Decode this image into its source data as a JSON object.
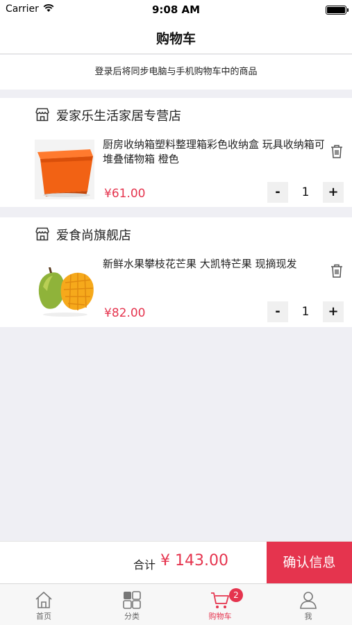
{
  "status_bar": {
    "carrier": "Carrier",
    "time": "9:08 AM"
  },
  "nav": {
    "title": "购物车"
  },
  "login_tip": "登录后将同步电脑与手机购物车中的商品",
  "stores": [
    {
      "name": "爱家乐生活家居专营店",
      "product": {
        "title": "厨房收纳箱塑料整理箱彩色收纳盒 玩具收纳箱可堆叠储物箱 橙色",
        "price": "¥61.00",
        "quantity": "1",
        "image": "orange-storage-box"
      }
    },
    {
      "name": "爱食尚旗舰店",
      "product": {
        "title": "新鲜水果攀枝花芒果 大凯特芒果 现摘现发",
        "price": "¥82.00",
        "quantity": "1",
        "image": "mango"
      }
    }
  ],
  "qty_controls": {
    "minus": "-",
    "plus": "+"
  },
  "checkout": {
    "total_label": "合计",
    "total_value": "¥ 143.00",
    "confirm_label": "确认信息"
  },
  "tabs": [
    {
      "label": "首页",
      "icon": "home-icon"
    },
    {
      "label": "分类",
      "icon": "grid-icon"
    },
    {
      "label": "购物车",
      "icon": "cart-icon",
      "badge": "2",
      "active": true
    },
    {
      "label": "我",
      "icon": "user-icon"
    }
  ],
  "colors": {
    "accent": "#e5344e",
    "background": "#efeff4"
  }
}
